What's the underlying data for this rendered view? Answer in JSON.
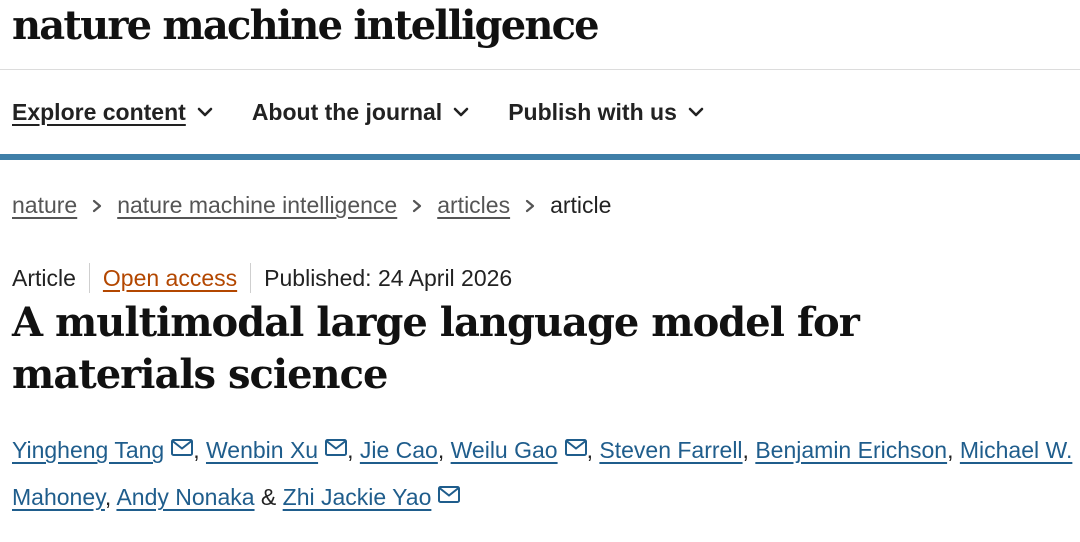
{
  "site": {
    "logo": "nature machine intelligence"
  },
  "nav": [
    {
      "label": "Explore content",
      "active": true
    },
    {
      "label": "About the journal",
      "active": false
    },
    {
      "label": "Publish with us",
      "active": false
    }
  ],
  "breadcrumb": {
    "items": [
      "nature",
      "nature machine intelligence",
      "articles"
    ],
    "current": "article"
  },
  "article": {
    "type": "Article",
    "access": "Open access",
    "published": "Published: 24 April 2026",
    "title": "A multimodal large language model for materials science"
  },
  "authors": {
    "list": [
      {
        "name": "Yingheng Tang",
        "email": true
      },
      {
        "name": "Wenbin Xu",
        "email": true
      },
      {
        "name": "Jie Cao",
        "email": false
      },
      {
        "name": "Weilu Gao",
        "email": true
      },
      {
        "name": "Steven Farrell",
        "email": false
      },
      {
        "name": "Benjamin Erichson",
        "email": false
      },
      {
        "name": "Michael W. Mahoney",
        "email": false
      },
      {
        "name": "Andy Nonaka",
        "email": false
      },
      {
        "name": "Zhi Jackie Yao",
        "email": true
      }
    ],
    "separator": ", ",
    "last_separator": " & "
  },
  "colors": {
    "accent_bar": "#3f7fa8",
    "author_link": "#1f5d8c",
    "open_access": "#b34700"
  },
  "icons": {
    "nav_chevron": "chevron-down-icon",
    "breadcrumb_sep": "chevron-right-icon",
    "author_mail": "mail-icon"
  }
}
